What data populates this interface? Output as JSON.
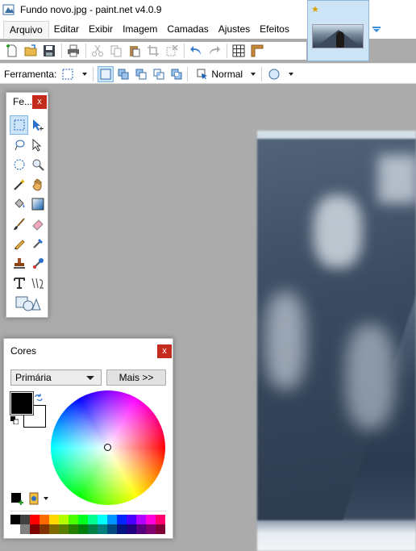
{
  "window": {
    "title": "Fundo novo.jpg - paint.net v4.0.9"
  },
  "menu": [
    "Arquivo",
    "Editar",
    "Exibir",
    "Imagem",
    "Camadas",
    "Ajustes",
    "Efeitos"
  ],
  "toolbar": {
    "tool_label": "Ferramenta:",
    "blend_mode": "Normal",
    "buttons": [
      "new-icon",
      "open-icon",
      "save-icon",
      "print-icon",
      "cut-icon",
      "copy-icon",
      "paste-icon",
      "crop-icon",
      "deselect-icon",
      "undo-icon",
      "redo-icon",
      "grid-icon",
      "ruler-icon"
    ]
  },
  "tools_window": {
    "title": "Fe...",
    "close": "x"
  },
  "colors_window": {
    "title": "Cores",
    "close": "x",
    "selected_channel": "Primária",
    "more_button": "Mais >>",
    "primary_color": "#000000",
    "secondary_color": "#ffffff"
  },
  "palette": {
    "row1": [
      "#000000",
      "#404040",
      "#ff0000",
      "#ff6a00",
      "#ffd800",
      "#b6ff00",
      "#4cff00",
      "#00ff21",
      "#00ff90",
      "#00ffff",
      "#0094ff",
      "#0026ff",
      "#4800ff",
      "#b200ff",
      "#ff00dc",
      "#ff006e"
    ],
    "row2": [
      "#ffffff",
      "#808080",
      "#7f0000",
      "#7f3300",
      "#7f6a00",
      "#5b7f00",
      "#267f00",
      "#007f0e",
      "#007f46",
      "#007f7f",
      "#004a7f",
      "#00137f",
      "#21007f",
      "#57007f",
      "#7f006e",
      "#7f0037"
    ]
  }
}
